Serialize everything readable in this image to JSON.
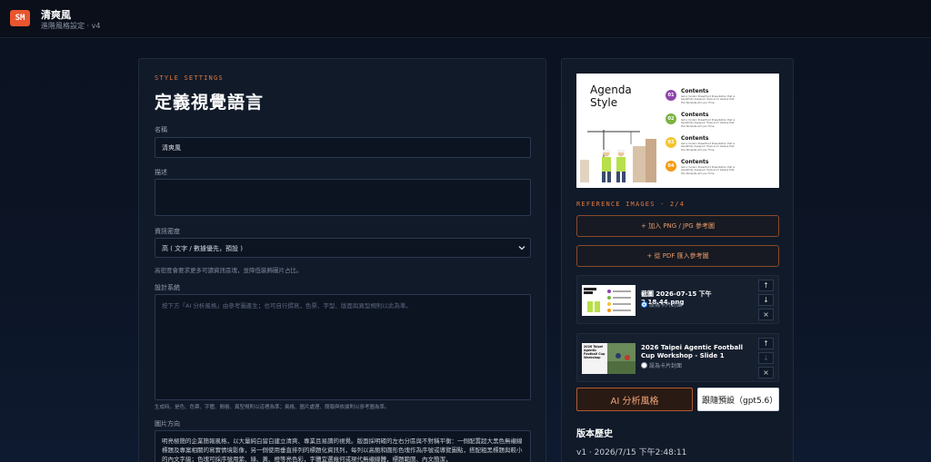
{
  "app": {
    "logo_text": "SM",
    "title": "清爽風",
    "subtitle": "進階風格設定 · v4"
  },
  "style_settings": {
    "kicker": "STYLE SETTINGS",
    "title": "定義視覺語言",
    "name_label": "名稱",
    "name_value": "清爽風",
    "description_label": "描述",
    "description_value": "",
    "density_label": "資訊密度",
    "density_value": "高 ( 文字 / 數據優先，預設 )",
    "density_hint": "高密度會要求更多可讀資訊區塊，並降低裝飾圖片占比。",
    "design_system_label": "設計系統",
    "design_system_placeholder": "按下方「AI 分析風格」由參考圖產生；也可自行撰寫，色票、字型、版面與異型規則以此為準。",
    "design_system_hint": "生成時，是色、色票、字體、間格、異型規則以這裡為準；風格、圖片處理、簡報與依據則以參考圖為準。",
    "image_direction_label": "圖片方向",
    "image_direction_text": "明亮極簡的企業簡報風格，以大量純白留白建立清爽、專業且易讀的視覺。版面採明確的左右分區與不對稱平衡：一側配置超大黑色無襯線標題及專案相關的寫實情境影像，另一側使用垂直排列的標題化資訊列，每列以高飽和圓形色塊作為序號或導覽圖點，搭配粗黑標題與較小的內文字級；色塊可採序號用紫、綠、黃、橙等亮色彩，字體宜選幾何或現代無襯線體，標題範圍、內文簡潔，"
  },
  "references": {
    "kicker": "REFERENCE IMAGES · 2/4",
    "add_image_label": "+ 加入 PNG / JPG 參考圖",
    "add_pdf_label": "+ 從 PDF 匯入參考圖",
    "items": [
      {
        "title": "截圖 2026-07-15 下午2.18.44.png",
        "radio_label": "設為卡片封面",
        "selected": true
      },
      {
        "title": "2026 Taipei Agentic Football Cup Workshop - Slide 1",
        "radio_label": "設為卡片封面",
        "selected": false
      }
    ],
    "move_up": "↑",
    "move_down": "↓",
    "remove": "×"
  },
  "preview": {
    "heading_line1": "Agenda",
    "heading_line2": "Style",
    "items": [
      {
        "num": "01",
        "title": "Contents",
        "color": "#8e44ad"
      },
      {
        "num": "02",
        "title": "Contents",
        "color": "#7cb342"
      },
      {
        "num": "03",
        "title": "Contents",
        "color": "#f4c430"
      },
      {
        "num": "04",
        "title": "Contents",
        "color": "#f39c12"
      }
    ],
    "body_text": "Get a modern PowerPoint Presentation that is beautifully designed. Hope and I believe that this Template will your Time."
  },
  "thumb2": {
    "line1": "2026 Taipei",
    "line2": "Agentic Football Cup",
    "line3": "Workshop"
  },
  "actions": {
    "analyze_label": "AI 分析風格",
    "model_value": "跟隨預設（gpt5.6）"
  },
  "history": {
    "title": "版本歷史",
    "items": [
      "v1 · 2026/7/15 下午2:48:11"
    ]
  },
  "colors": {
    "accent": "#e0793e",
    "panel": "#111a29",
    "background": "#0b1220"
  }
}
